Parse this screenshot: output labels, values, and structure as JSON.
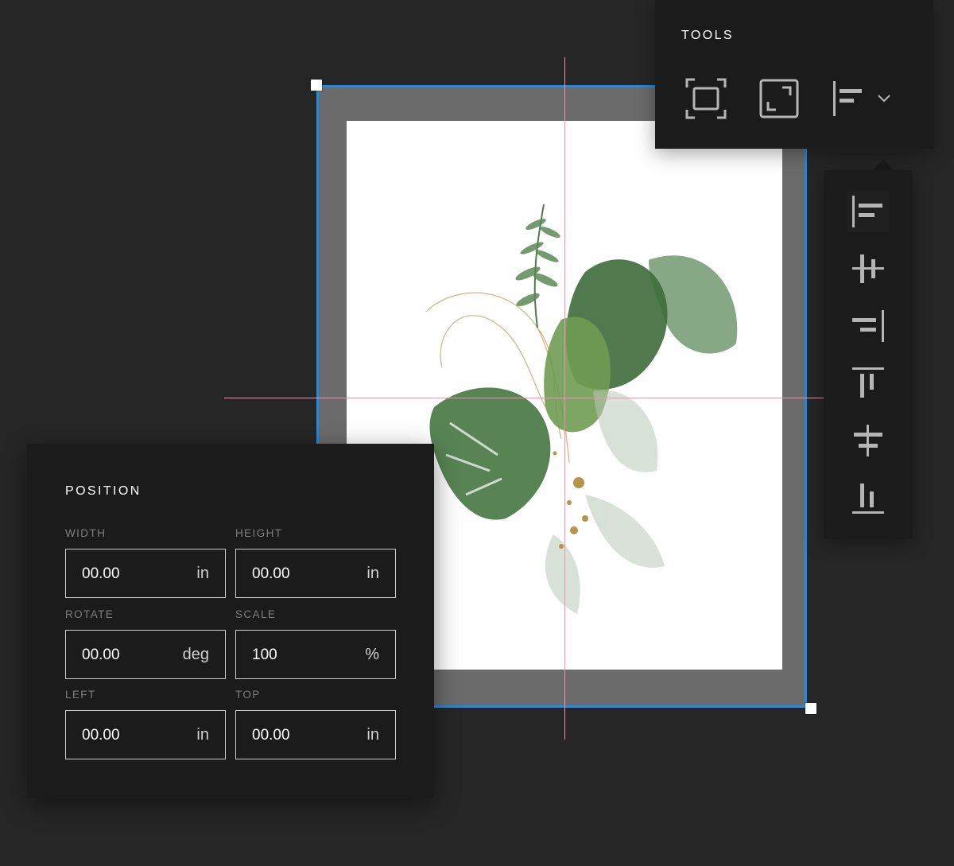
{
  "tools": {
    "title": "TOOLS",
    "buttons": [
      {
        "icon": "fit-frame-icon"
      },
      {
        "icon": "expand-icon"
      },
      {
        "icon": "align-left-icon",
        "dropdown": "chevron-down-icon"
      }
    ]
  },
  "align_menu": {
    "items": [
      {
        "icon": "align-left-icon",
        "active": true
      },
      {
        "icon": "align-horizontal-center-icon"
      },
      {
        "icon": "align-right-icon"
      },
      {
        "icon": "align-top-icon"
      },
      {
        "icon": "align-vertical-center-icon"
      },
      {
        "icon": "align-bottom-icon"
      }
    ]
  },
  "position": {
    "title": "POSITION",
    "fields": {
      "width": {
        "label": "WIDTH",
        "value": "00.00",
        "unit": "in"
      },
      "height": {
        "label": "HEIGHT",
        "value": "00.00",
        "unit": "in"
      },
      "rotate": {
        "label": "ROTATE",
        "value": "00.00",
        "unit": "deg"
      },
      "scale": {
        "label": "SCALE",
        "value": "100",
        "unit": "%"
      },
      "left": {
        "label": "LEFT",
        "value": "00.00",
        "unit": "in"
      },
      "top": {
        "label": "TOP",
        "value": "00.00",
        "unit": "in"
      }
    }
  },
  "colors": {
    "background": "#262626",
    "panel": "#1b1b1b",
    "selection": "#1d8be8",
    "guide": "#f291b0",
    "mat": "#6b6b6b"
  }
}
